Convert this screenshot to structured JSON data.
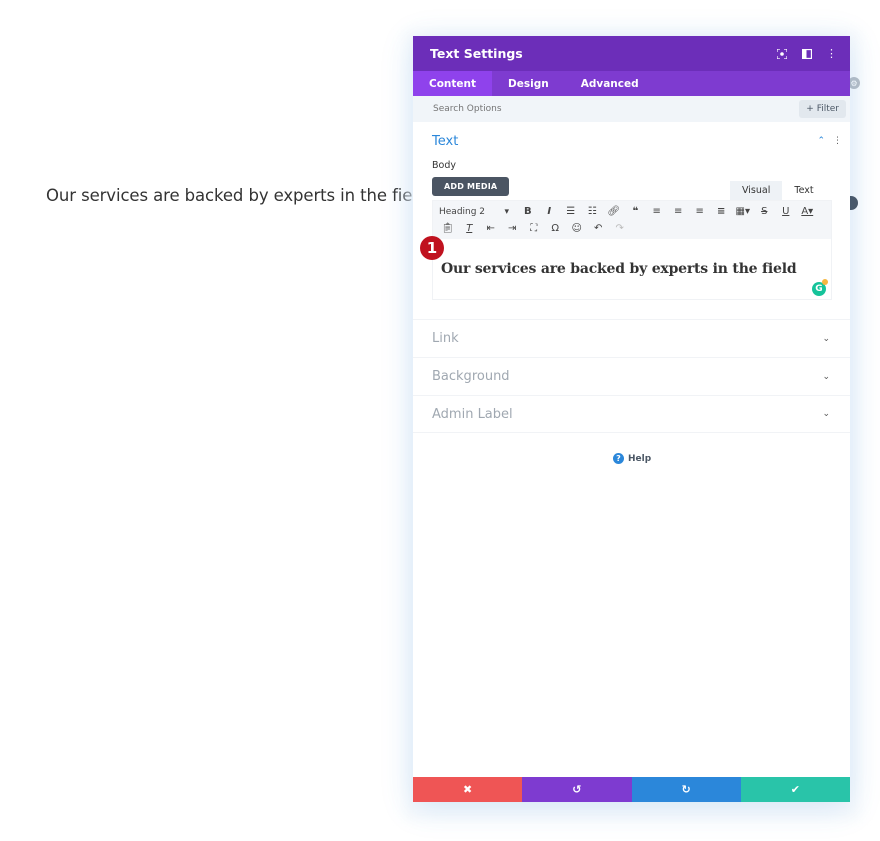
{
  "page": {
    "body_text": "Our services are backed by experts in the field"
  },
  "panel": {
    "title": "Text Settings",
    "header_icons": [
      "focus-icon",
      "split-view-icon",
      "more-options-icon"
    ],
    "tabs": [
      {
        "label": "Content",
        "active": true
      },
      {
        "label": "Design",
        "active": false
      },
      {
        "label": "Advanced",
        "active": false
      }
    ],
    "search": {
      "placeholder": "Search Options",
      "value": ""
    },
    "filter_label": "+ Filter",
    "text_section": {
      "title": "Text",
      "body_label": "Body",
      "add_media_label": "ADD MEDIA",
      "mode_tabs": [
        "Visual",
        "Text"
      ],
      "format_select": "Heading 2",
      "editor_content": "Our services are backed by experts in the field",
      "step_badge": "1"
    },
    "sections": [
      {
        "label": "Link"
      },
      {
        "label": "Background"
      },
      {
        "label": "Admin Label"
      }
    ],
    "help_label": "Help",
    "footer": {
      "colors": {
        "cancel": "#ef5555",
        "undo": "#7e3bd0",
        "redo": "#2b87da",
        "save": "#29c4a9"
      }
    }
  },
  "colors": {
    "header": "#6c2eb9",
    "tabs": "#7e3bd0",
    "active_tab": "#8f42ec",
    "accent_blue": "#2b87da",
    "badge": "#c0121f"
  }
}
